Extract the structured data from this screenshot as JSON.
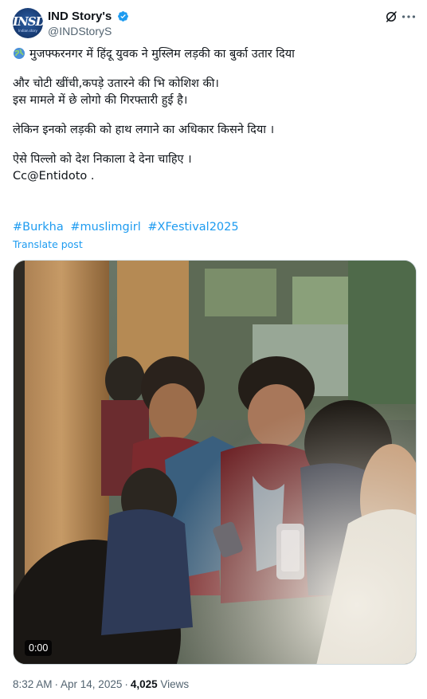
{
  "author": {
    "display_name": "IND Story's",
    "handle": "@INDStoryS",
    "avatar_text": "INSD",
    "avatar_sub": "Indian.story"
  },
  "colors": {
    "link": "#1d9bf0",
    "verified": "#1d9bf0",
    "muted": "#536471"
  },
  "post": {
    "line1": "मुजफ्फरनगर में हिंदू युवक ने मुस्लिम लड़की का बुर्का उतार दिया",
    "line2": "और चोटी खींची,कपड़े उतारने की भि कोशिश की।",
    "line3": "इस मामले में छे लोगो की गिरफ्तारी हुई है।",
    "line4": "लेकिन इनको लड़की को हाथ लगाने का अधिकार किसने दिया ।",
    "line5": "ऐसे पिल्लो को देश निकाला दे देना चाहिए ।",
    "line6": "Cc@Entidoto .",
    "hashtags": [
      "#Burkha",
      "#muslimgirl",
      "#XFestival2025"
    ],
    "translate_label": "Translate post"
  },
  "media": {
    "duration": "0:00"
  },
  "meta": {
    "time": "8:32 AM",
    "date": "Apr 14, 2025",
    "views_count": "4,025",
    "views_label": "Views"
  },
  "icons": [
    "verified-badge-icon",
    "grok-icon",
    "more-icon",
    "globe-icon"
  ]
}
